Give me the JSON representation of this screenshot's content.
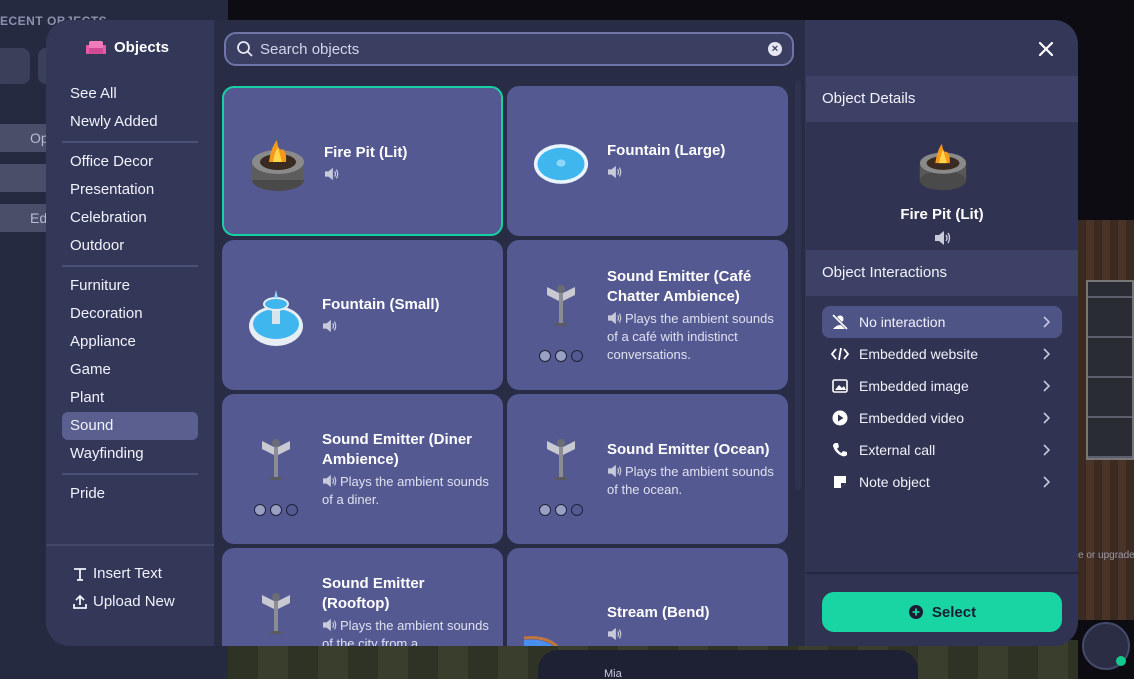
{
  "background": {
    "recent_objects_label": "ECENT OBJECTS",
    "left_pill_1": "Op",
    "left_pill_2": "Ed",
    "hint_text": "e or upgrade",
    "player_name": "Mia"
  },
  "modal": {
    "title": "Objects",
    "search": {
      "placeholder": "Search objects",
      "value": ""
    },
    "nav": {
      "group1": [
        "See All",
        "Newly Added"
      ],
      "group2": [
        "Office Decor",
        "Presentation",
        "Celebration",
        "Outdoor"
      ],
      "group3": [
        "Furniture",
        "Decoration",
        "Appliance",
        "Game",
        "Plant",
        "Sound",
        "Wayfinding"
      ],
      "group4": [
        "Pride"
      ],
      "active": "Sound"
    },
    "actions": {
      "insert_text": "Insert Text",
      "upload_new": "Upload New"
    },
    "cards": [
      {
        "name": "Fire Pit (Lit)",
        "desc": "",
        "icon": "fire-pit",
        "selected": true
      },
      {
        "name": "Fountain (Large)",
        "desc": "",
        "icon": "fountain-large",
        "selected": false
      },
      {
        "name": "Fountain (Small)",
        "desc": "",
        "icon": "fountain-small",
        "selected": false
      },
      {
        "name": "Sound Emitter (Café Chatter Ambience)",
        "desc": "Plays the ambient sounds of a café with indistinct conversations.",
        "icon": "sound-emitter",
        "selected": false
      },
      {
        "name": "Sound Emitter (Diner Ambience)",
        "desc": "Plays the ambient sounds of a diner.",
        "icon": "sound-emitter",
        "selected": false
      },
      {
        "name": "Sound Emitter (Ocean)",
        "desc": "Plays the ambient sounds of the ocean.",
        "icon": "sound-emitter",
        "selected": false
      },
      {
        "name": "Sound Emitter (Rooftop)",
        "desc": "Plays the ambient sounds of the city from a",
        "icon": "sound-emitter",
        "selected": false
      },
      {
        "name": "Stream (Bend)",
        "desc": "",
        "icon": "stream-bend",
        "selected": false
      }
    ],
    "details": {
      "header": "Object Details",
      "selected_name": "Fire Pit (Lit)",
      "interactions_header": "Object Interactions",
      "interactions": [
        {
          "label": "No interaction",
          "icon": "no-user-icon",
          "active": true
        },
        {
          "label": "Embedded website",
          "icon": "code-icon",
          "active": false
        },
        {
          "label": "Embedded image",
          "icon": "image-icon",
          "active": false
        },
        {
          "label": "Embedded video",
          "icon": "play-icon",
          "active": false
        },
        {
          "label": "External call",
          "icon": "phone-icon",
          "active": false
        },
        {
          "label": "Note object",
          "icon": "note-icon",
          "active": false
        }
      ],
      "select_label": "Select"
    }
  },
  "colors": {
    "accent": "#18d5a3",
    "card": "#545991",
    "panel": "#333758"
  }
}
